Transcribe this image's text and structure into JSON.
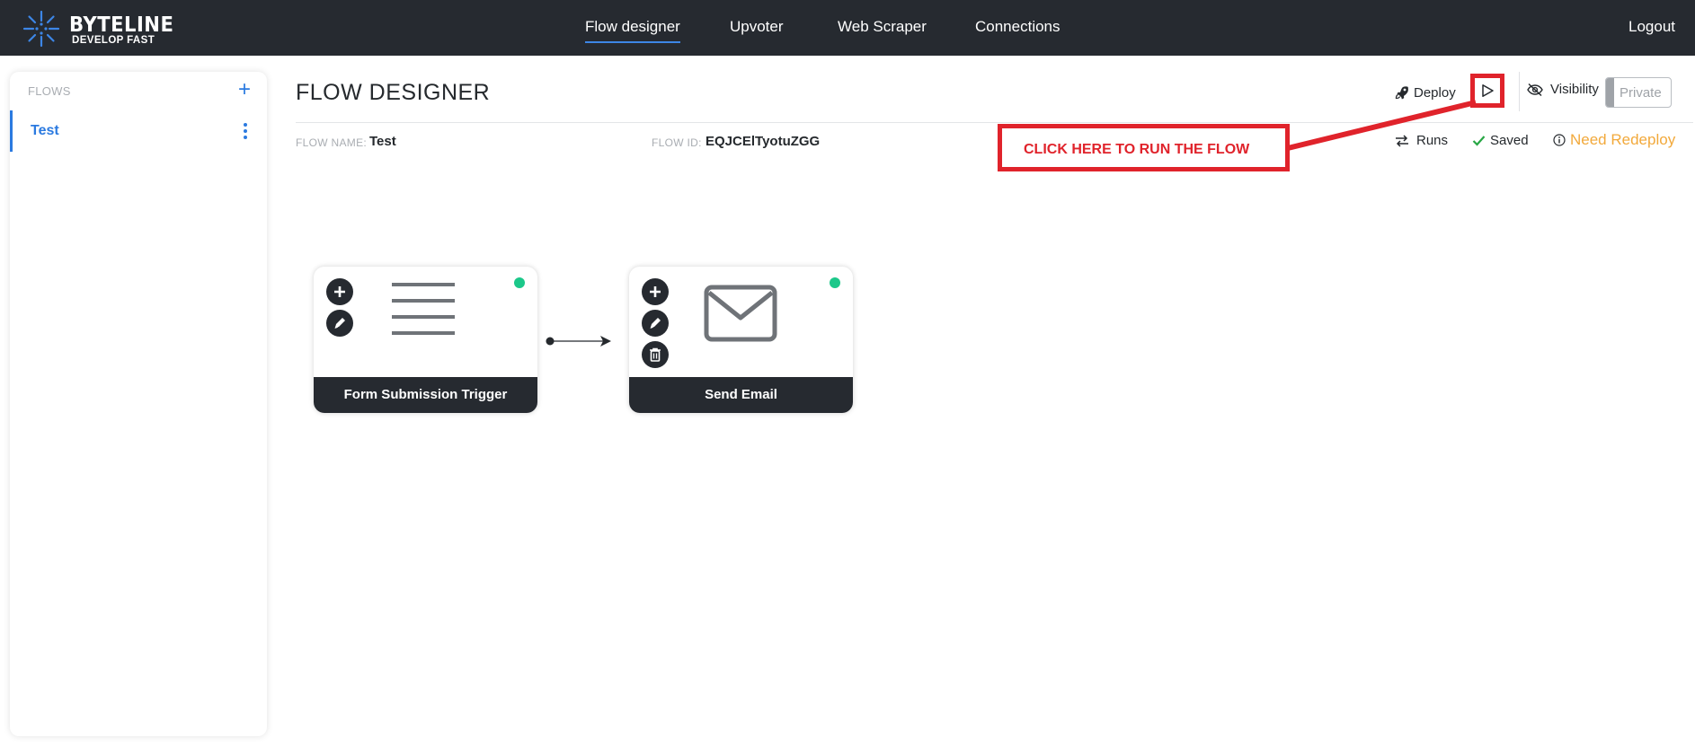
{
  "brand": {
    "name": "BYTELINE",
    "tagline": "DEVELOP FAST",
    "accent_color": "#3d86e6"
  },
  "nav": {
    "links": [
      {
        "label": "Flow designer",
        "active": true
      },
      {
        "label": "Upvoter",
        "active": false
      },
      {
        "label": "Web Scraper",
        "active": false
      },
      {
        "label": "Connections",
        "active": false
      }
    ],
    "logout_label": "Logout"
  },
  "sidebar": {
    "section_label": "FLOWS",
    "add_icon": "plus-icon",
    "items": [
      {
        "label": "Test",
        "selected": true,
        "menu_icon": "kebab-menu-icon"
      }
    ]
  },
  "header": {
    "title": "FLOW DESIGNER",
    "deploy_label": "Deploy",
    "deploy_icon": "rocket-icon",
    "run_icon": "play-icon",
    "visibility_label": "Visibility",
    "visibility_icon": "eye-slash-icon",
    "visibility_value": "Private"
  },
  "meta": {
    "flow_name_label": "FLOW NAME:",
    "flow_name": "Test",
    "flow_id_label": "FLOW ID:",
    "flow_id": "EQJCElTyotuZGG",
    "runs_label": "Runs",
    "saved_label": "Saved",
    "redeploy_label": "Need Redeploy",
    "redeploy_color": "#f2a93b",
    "saved_color": "#28a745"
  },
  "callout": {
    "text": "CLICK HERE TO RUN THE FLOW",
    "color": "#e0232b"
  },
  "nodes": [
    {
      "title": "Form Submission Trigger",
      "icon": "form-lines-icon",
      "status_color": "#1cc88a",
      "actions": [
        "add",
        "edit"
      ]
    },
    {
      "title": "Send Email",
      "icon": "envelope-icon",
      "status_color": "#1cc88a",
      "actions": [
        "add",
        "edit",
        "delete"
      ]
    }
  ]
}
